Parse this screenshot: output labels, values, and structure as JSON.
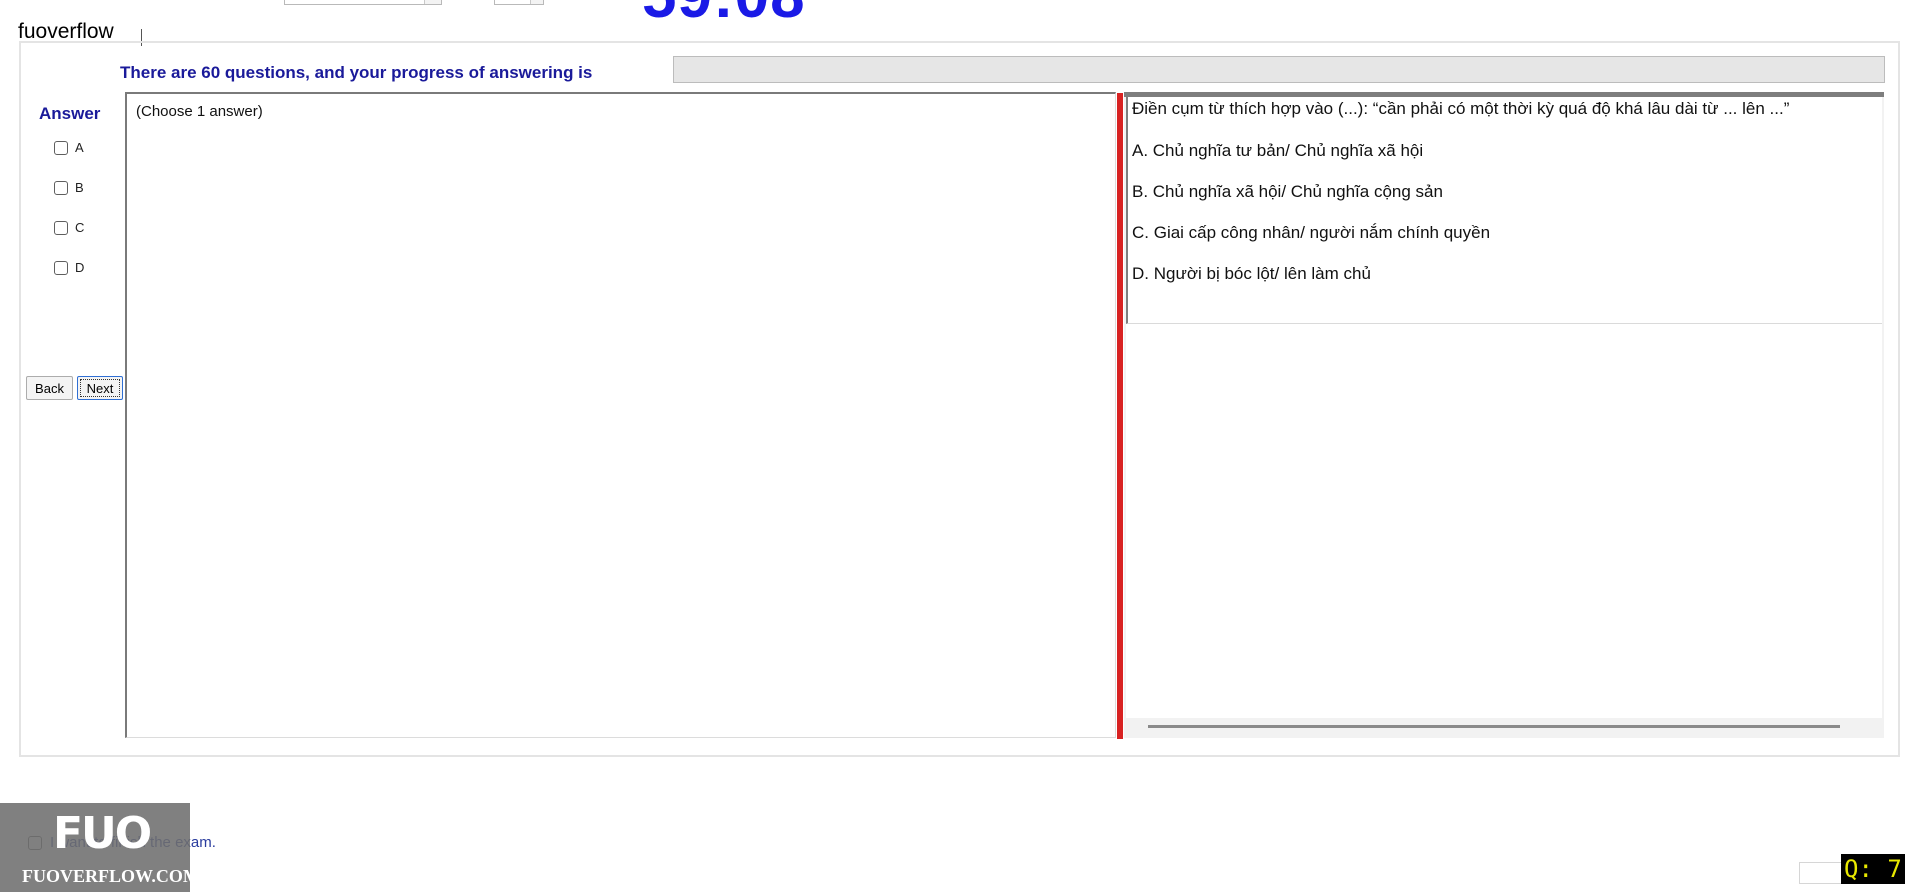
{
  "header": {
    "timer": "59:08",
    "brand": "fuoverflow"
  },
  "progress": {
    "label": "There are 60 questions, and your progress of answering is",
    "value": 0
  },
  "answer": {
    "heading": "Answer",
    "options": [
      "A",
      "B",
      "C",
      "D"
    ],
    "hint": "(Choose 1 answer)"
  },
  "navigation": {
    "back_label": "Back",
    "next_label": "Next"
  },
  "question": {
    "text": "Điền cụm từ thích hợp vào (...): “cần phải có một thời kỳ quá độ khá lâu dài từ ... lên ...”",
    "choices": [
      "A.  Chủ nghĩa tư bản/ Chủ nghĩa xã hội",
      "B.  Chủ nghĩa xã hội/ Chủ nghĩa cộng sản",
      "C.  Giai cấp công nhân/ người nắm chính quyền",
      "D.  Người bị bóc lột/ lên làm chủ"
    ]
  },
  "footer": {
    "finish_label": "I want to finish the exam.",
    "logo_mark": "FUO",
    "logo_text": "FUOVERFLOW.COM",
    "question_counter": "Q: 7"
  },
  "colors": {
    "accent_blue": "#1a1a9a",
    "timer_blue": "#1a1ae6",
    "splitter_red": "#d82222",
    "counter_yellow": "#e8e800"
  }
}
